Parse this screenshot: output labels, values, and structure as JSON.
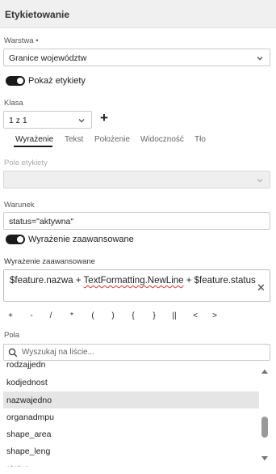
{
  "header": {
    "title": "Etykietowanie"
  },
  "layer": {
    "label": "Warstwa •",
    "value": "Granice województw"
  },
  "show_labels": {
    "label": "Pokaż etykiety",
    "on": true
  },
  "class": {
    "label": "Klasa",
    "value": "1 z 1",
    "add_glyph": "+"
  },
  "tabs": [
    {
      "label": "Wyrażenie",
      "active": true
    },
    {
      "label": "Tekst",
      "active": false
    },
    {
      "label": "Położenie",
      "active": false
    },
    {
      "label": "Widoczność",
      "active": false
    },
    {
      "label": "Tło",
      "active": false
    }
  ],
  "label_field": {
    "label": "Pole etykiety",
    "value": ""
  },
  "condition": {
    "label": "Warunek",
    "value": "status=\"aktywna\""
  },
  "advanced_toggle": {
    "label": "Wyrażenie zaawansowane",
    "on": true
  },
  "advanced_expression": {
    "label": "Wyrażenie zaawansowane",
    "part1": "$feature.nazwa + ",
    "part2": "TextFormatting.NewLine",
    "part3": " + $feature.status",
    "clear_glyph": "✕"
  },
  "operators": [
    "+",
    "-",
    "/",
    "*",
    "(",
    ")",
    "{",
    "}",
    "||",
    "<",
    ">"
  ],
  "fields": {
    "label": "Pola",
    "search_placeholder": "Wyszukaj na liście...",
    "items": [
      "rodzajjedn",
      "kodjednost",
      "nazwajedno",
      "organadmpu",
      "shape_area",
      "shape_leng",
      "status"
    ],
    "selected": "nazwajedno"
  },
  "icons": {
    "chevron": "chevron-down-icon",
    "search": "search-icon",
    "clear": "close-icon",
    "plus": "plus-icon"
  },
  "colors": {
    "toggle_on": "#1a1a1a",
    "selected_row": "#e5e5e5",
    "header_bg": "#f0f0f0",
    "spell_error": "#d9342b"
  }
}
